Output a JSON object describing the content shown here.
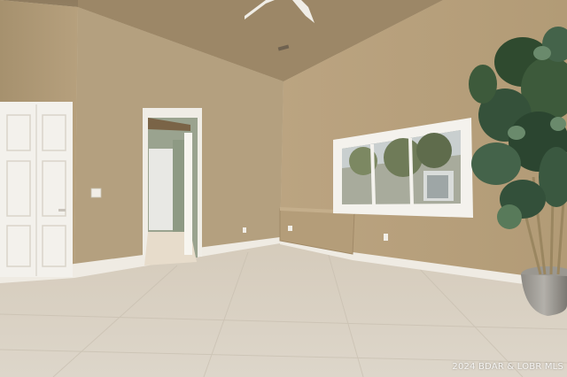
{
  "photo": {
    "subject": "empty-bedroom-interior",
    "watermark": "2024 BDAR & LOBR MLS"
  },
  "colors": {
    "wall": "#b9a27f",
    "ceiling": "#a89373",
    "floor": "#d8d0c2",
    "trim": "#f1eee7",
    "plant": "#3d5a3b"
  }
}
